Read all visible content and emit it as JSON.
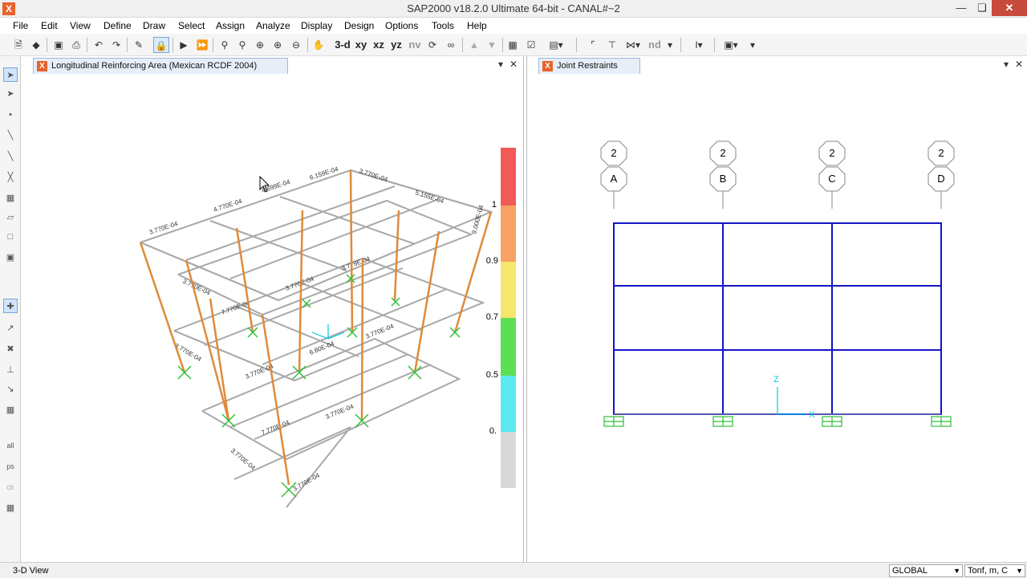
{
  "window": {
    "title": "SAP2000 v18.2.0 Ultimate 64-bit - CANAL#~2",
    "icon_glyph": "X"
  },
  "menubar": {
    "items": [
      "File",
      "Edit",
      "View",
      "Define",
      "Draw",
      "Select",
      "Assign",
      "Analyze",
      "Display",
      "Design",
      "Options",
      "Tools",
      "Help"
    ]
  },
  "toolbar": {
    "view_3d": "3-d",
    "view_xy": "xy",
    "view_xz": "xz",
    "view_yz": "yz",
    "view_nv": "nv",
    "nd": "nd",
    "icons": [
      "new-model-icon",
      "open-icon",
      "save-icon",
      "print-icon",
      "undo-icon",
      "redo-icon",
      "pencil-icon",
      "lock-icon",
      "run-icon",
      "run-step-icon",
      "zoom-window-icon",
      "zoom-restore-icon",
      "zoom-in-icon",
      "zoom-out-icon",
      "pan-icon",
      "rotate-icon",
      "perspective-icon",
      "move-up-icon",
      "move-down-icon",
      "assign-display-icon",
      "check-icon",
      "object-shrink-icon",
      "frame-icon",
      "column-icon",
      "brace-icon",
      "section-icon",
      "area-icon"
    ]
  },
  "left_pane": {
    "tab_title": "Longitudinal Reinforcing Area  (Mexican RCDF 2004)",
    "legend": {
      "labels": [
        "1",
        "0.9",
        "0.7",
        "0.5",
        "0."
      ],
      "colors": [
        "#f25a5a",
        "#f7a264",
        "#f5e66c",
        "#5ede55",
        "#5ce8f0",
        "#d8d8d8"
      ]
    },
    "frame_labels": [
      "3.770E-04",
      "4.770E-04",
      "6.159E-04",
      "4.699E-04",
      "5.155E-04",
      "9.000E-04",
      "7.770E-04",
      "3.779E-04",
      "6.60E-04"
    ]
  },
  "right_pane": {
    "tab_title": "Joint Restraints",
    "grid_bubbles": [
      {
        "row_top": "2",
        "row_bottom": "A"
      },
      {
        "row_top": "2",
        "row_bottom": "B"
      },
      {
        "row_top": "2",
        "row_bottom": "C"
      },
      {
        "row_top": "2",
        "row_bottom": "D"
      }
    ],
    "axis_labels": {
      "z": "Z",
      "x": "X"
    },
    "frame_color": "#1414c8"
  },
  "statusbar": {
    "text": "3-D View",
    "coord_system": "GLOBAL",
    "units": "Tonf, m, C"
  }
}
